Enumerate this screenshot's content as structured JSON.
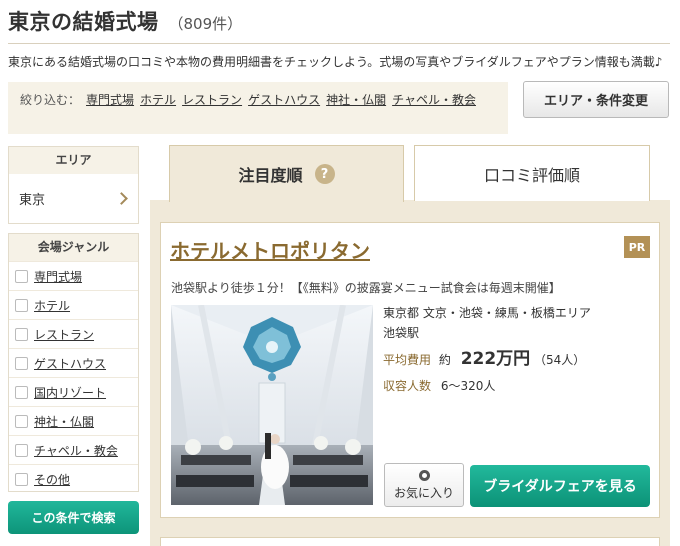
{
  "page": {
    "title": "東京の結婚式場",
    "count": "（809件）"
  },
  "lead": "東京にある結婚式場の口コミや本物の費用明細書をチェックしよう。式場の写真やブライダルフェアやプラン情報も満載♪",
  "filter": {
    "label": "絞り込む：",
    "links": [
      "専門式場",
      "ホテル",
      "レストラン",
      "ゲストハウス",
      "神社・仏閣",
      "チャペル・教会"
    ]
  },
  "change_button": "エリア・条件変更",
  "area": {
    "header": "エリア",
    "value": "東京"
  },
  "genre": {
    "header": "会場ジャンル",
    "items": [
      "専門式場",
      "ホテル",
      "レストラン",
      "ゲストハウス",
      "国内リゾート",
      "神社・仏閣",
      "チャペル・教会",
      "その他"
    ]
  },
  "search_button": "この条件で検索",
  "tabs": {
    "active": "注目度順",
    "help": "?",
    "inactive": "口コミ評価順"
  },
  "card": {
    "name": "ホテルメトロポリタン",
    "pr": "PR",
    "catch": "池袋駅より徒歩１分！【《無料》の披露宴メニュー試食会は毎週末開催】",
    "area": "東京都 文京・池袋・練馬・板橋エリア",
    "station": "池袋駅",
    "price_label": "平均費用",
    "price_prefix": "約",
    "price_value": "222万円",
    "price_people": "（54人）",
    "capacity_label": "収容人数",
    "capacity_value": "6〜320人",
    "fav_label": "お気に入り",
    "fair_button": "ブライダルフェアを見る"
  },
  "colors": {
    "accent_green": "#0d9479",
    "brand_brown": "#8a6a30",
    "panel_beige": "#f0e9d9"
  }
}
